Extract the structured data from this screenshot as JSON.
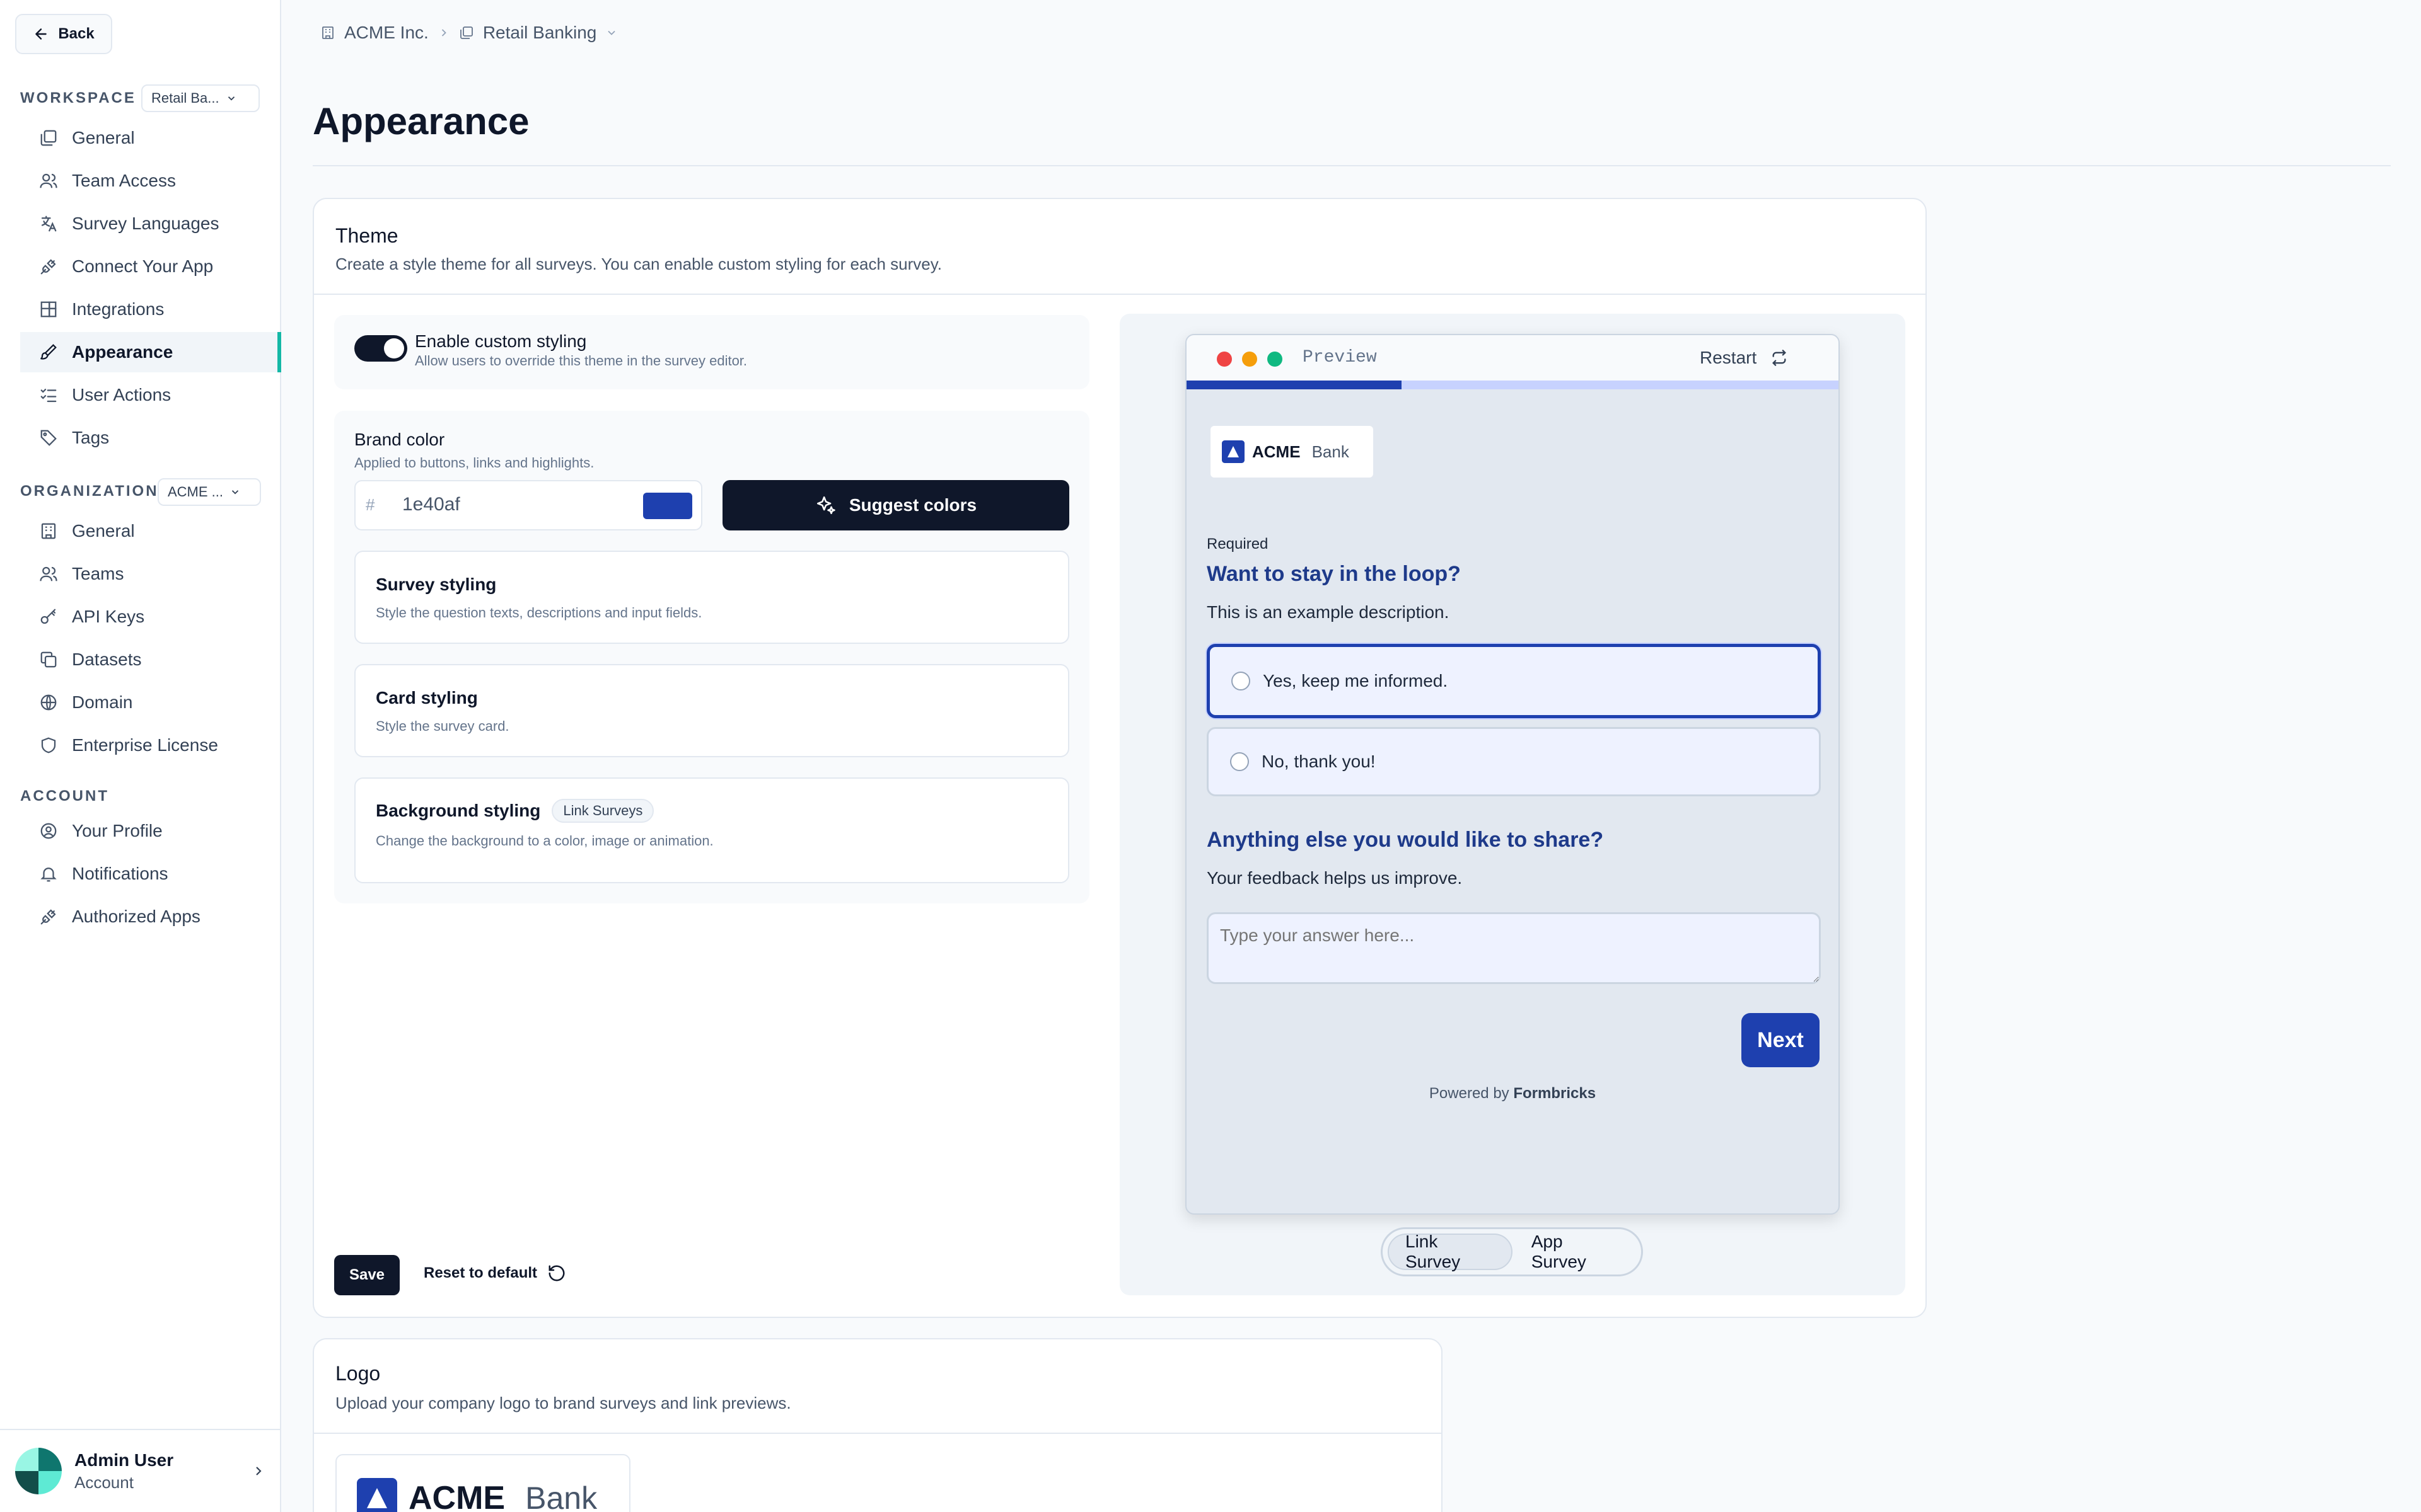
{
  "sidebar": {
    "back_label": "Back",
    "workspace_label": "WORKSPACE",
    "workspace_select": "Retail Ba...",
    "workspace_items": [
      {
        "label": "General",
        "icon": "window-icon"
      },
      {
        "label": "Team Access",
        "icon": "users-icon"
      },
      {
        "label": "Survey Languages",
        "icon": "languages-icon"
      },
      {
        "label": "Connect Your App",
        "icon": "plug-icon"
      },
      {
        "label": "Integrations",
        "icon": "blocks-icon"
      },
      {
        "label": "Appearance",
        "icon": "brush-icon",
        "active": true
      },
      {
        "label": "User Actions",
        "icon": "list-checks-icon"
      },
      {
        "label": "Tags",
        "icon": "tag-icon"
      }
    ],
    "organization_label": "ORGANIZATION",
    "organization_select": "ACME ...",
    "organization_items": [
      {
        "label": "General",
        "icon": "building-icon"
      },
      {
        "label": "Teams",
        "icon": "users-icon"
      },
      {
        "label": "API Keys",
        "icon": "key-icon"
      },
      {
        "label": "Datasets",
        "icon": "copy-icon"
      },
      {
        "label": "Domain",
        "icon": "globe-icon"
      },
      {
        "label": "Enterprise License",
        "icon": "shield-icon"
      }
    ],
    "account_label": "ACCOUNT",
    "account_items": [
      {
        "label": "Your Profile",
        "icon": "user-circle-icon"
      },
      {
        "label": "Notifications",
        "icon": "bell-icon"
      },
      {
        "label": "Authorized Apps",
        "icon": "plug-icon"
      }
    ],
    "user_name": "Admin User",
    "user_sub": "Account"
  },
  "breadcrumb": {
    "org": "ACME Inc.",
    "workspace": "Retail Banking"
  },
  "page_title": "Appearance",
  "theme": {
    "title": "Theme",
    "description": "Create a style theme for all surveys. You can enable custom styling for each survey.",
    "toggle_title": "Enable custom styling",
    "toggle_desc": "Allow users to override this theme in the survey editor.",
    "brand_title": "Brand color",
    "brand_desc": "Applied to buttons, links and highlights.",
    "hash": "#",
    "brand_value": "1e40af",
    "brand_color": "#1e40af",
    "suggest_label": "Suggest colors",
    "survey_styling_title": "Survey styling",
    "survey_styling_desc": "Style the question texts, descriptions and input fields.",
    "card_styling_title": "Card styling",
    "card_styling_desc": "Style the survey card.",
    "bg_styling_title": "Background styling",
    "bg_styling_badge": "Link Surveys",
    "bg_styling_desc": "Change the background to a color, image or animation.",
    "save_label": "Save",
    "reset_label": "Reset to default"
  },
  "preview": {
    "label": "Preview",
    "restart_label": "Restart",
    "progress": 0.33,
    "logo_brand": "ACME",
    "logo_sub": "Bank",
    "required_label": "Required",
    "q1_title": "Want to stay in the loop?",
    "q1_desc": "This is an example description.",
    "q1_options": [
      "Yes, keep me informed.",
      "No, thank you!"
    ],
    "q2_title": "Anything else you would like to share?",
    "q2_desc": "Your feedback helps us improve.",
    "q2_placeholder": "Type your answer here...",
    "next_label": "Next",
    "powered_prefix": "Powered by",
    "powered_brand": "Formbricks",
    "tabs": [
      "Link Survey",
      "App Survey"
    ]
  },
  "logo_section": {
    "title": "Logo",
    "description": "Upload your company logo to brand surveys and link previews.",
    "brand": "ACME",
    "sub": "Bank"
  }
}
